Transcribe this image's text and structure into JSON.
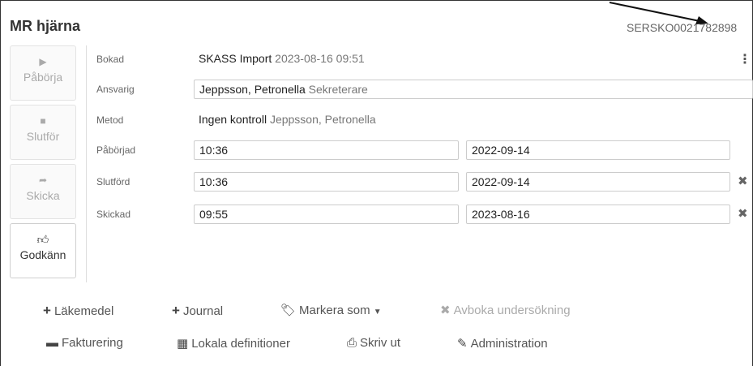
{
  "header": {
    "title": "MR hjärna",
    "reference_id": "SERSKO0021782898"
  },
  "side_actions": [
    {
      "label": "Påbörja",
      "icon": "play-icon",
      "enabled": false
    },
    {
      "label": "Slutför",
      "icon": "stop-icon",
      "enabled": false
    },
    {
      "label": "Skicka",
      "icon": "share-icon",
      "enabled": false
    },
    {
      "label": "Godkänn",
      "icon": "thumbs-up-icon",
      "enabled": true
    }
  ],
  "details": {
    "booked": {
      "label": "Bokad",
      "value": "SKASS Import",
      "timestamp": "2023-08-16 09:51"
    },
    "responsible": {
      "label": "Ansvarig",
      "value": "Jeppsson, Petronella",
      "role": "Sekreterare"
    },
    "method": {
      "label": "Metod",
      "value": "Ingen kontroll",
      "person": "Jeppsson, Petronella"
    },
    "started": {
      "label": "Påbörjad",
      "time": "10:36",
      "date": "2022-09-14"
    },
    "finished": {
      "label": "Slutförd",
      "time": "10:36",
      "date": "2022-09-14"
    },
    "sent": {
      "label": "Skickad",
      "time": "09:55",
      "date": "2023-08-16"
    }
  },
  "bottom_actions": {
    "medication": "Läkemedel",
    "journal": "Journal",
    "mark_as": "Markera som",
    "cancel_exam": "Avboka undersökning",
    "billing": "Fakturering",
    "local_definitions": "Lokala definitioner",
    "print": "Skriv ut",
    "administration": "Administration"
  },
  "icons": {
    "menu": "vertical-dots-icon",
    "clear": "close-icon",
    "plus": "plus-icon",
    "tag": "tag-icon",
    "caret": "caret-down-icon",
    "cross": "close-icon",
    "card": "credit-card-icon",
    "calculator": "calculator-icon",
    "printer": "printer-icon",
    "edit": "edit-icon"
  },
  "colors": {
    "text": "#333333",
    "muted": "#aaaaaa",
    "border": "#cccccc"
  }
}
